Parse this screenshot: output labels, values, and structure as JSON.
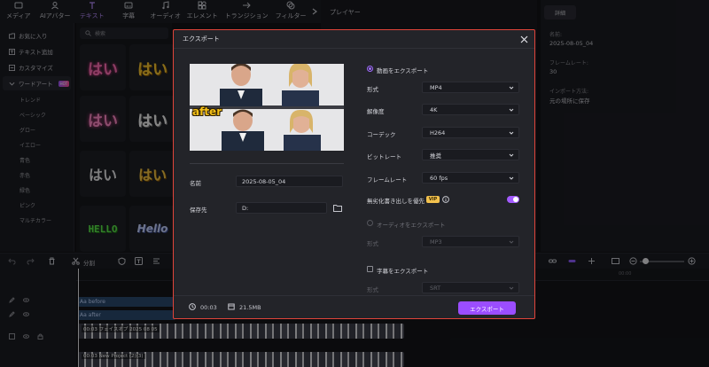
{
  "top_tabs": [
    {
      "label": "メディア",
      "icon": "media-icon"
    },
    {
      "label": "AIアバター",
      "icon": "avatar-icon"
    },
    {
      "label": "テキスト",
      "icon": "text-icon",
      "active": true
    },
    {
      "label": "字幕",
      "icon": "subtitle-icon"
    },
    {
      "label": "オーディオ",
      "icon": "audio-icon"
    },
    {
      "label": "エレメント",
      "icon": "element-icon"
    },
    {
      "label": "トランジション",
      "icon": "transition-icon"
    },
    {
      "label": "フィルター",
      "icon": "filter-icon"
    }
  ],
  "sidebar": {
    "items": [
      {
        "label": "お気に入り",
        "icon": "folder-icon"
      },
      {
        "label": "テキスト追加",
        "icon": "text-add-icon"
      },
      {
        "label": "カスタマイズ",
        "icon": "customize-icon"
      },
      {
        "label": "ワードアート",
        "icon": "chevron-down-icon",
        "badge": "HOT"
      }
    ],
    "sub_items": [
      "トレンド",
      "ベーシック",
      "グロー",
      "イエロー",
      "青色",
      "赤色",
      "緑色",
      "ピンク",
      "マルチカラー"
    ]
  },
  "assets": {
    "search_placeholder": "検索",
    "tiles": [
      "はい",
      "はい",
      "はい",
      "はい",
      "はい",
      "はい",
      "HELLO",
      "Hello"
    ]
  },
  "player": {
    "title": "プレイヤー"
  },
  "details": {
    "tab": "詳細",
    "name_label": "名前:",
    "name_value": "2025-08-05_04",
    "fps_label": "フレームレート:",
    "fps_value": "30",
    "import_label": "インポート方法:",
    "import_value": "元の場所に保存"
  },
  "timeline": {
    "split_label": "分割",
    "tracks": [
      {
        "label": "Aa before"
      },
      {
        "label": "Aa after"
      },
      {
        "label": "00:03 フェイスオプ 2025 08 05"
      },
      {
        "label": "00:03 New Project (2)(3)"
      }
    ]
  },
  "export_dialog": {
    "title": "エクスポート",
    "preview_caption": "after",
    "name_label": "名前",
    "name_value": "2025-08-05_04",
    "save_label": "保存先",
    "save_value": "D:",
    "video_export_label": "動画をエクスポート",
    "format_label": "形式",
    "format_value": "MP4",
    "resolution_label": "解像度",
    "resolution_value": "4K",
    "codec_label": "コーデック",
    "codec_value": "H264",
    "bitrate_label": "ビットレート",
    "bitrate_value": "推奨",
    "framerate_label": "フレームレート",
    "framerate_value": "60  fps",
    "lossless_label": "無劣化書き出しを優先",
    "vip_badge": "VIP",
    "lossless_enabled": true,
    "audio_export_label": "オーディオをエクスポート",
    "audio_format_label": "形式",
    "audio_format_value": "MP3",
    "subtitle_export_label": "字幕をエクスポート",
    "subtitle_format_label": "形式",
    "subtitle_format_value": "SRT",
    "duration": "00:03",
    "filesize": "21.5MB",
    "export_button": "エクスポート"
  }
}
